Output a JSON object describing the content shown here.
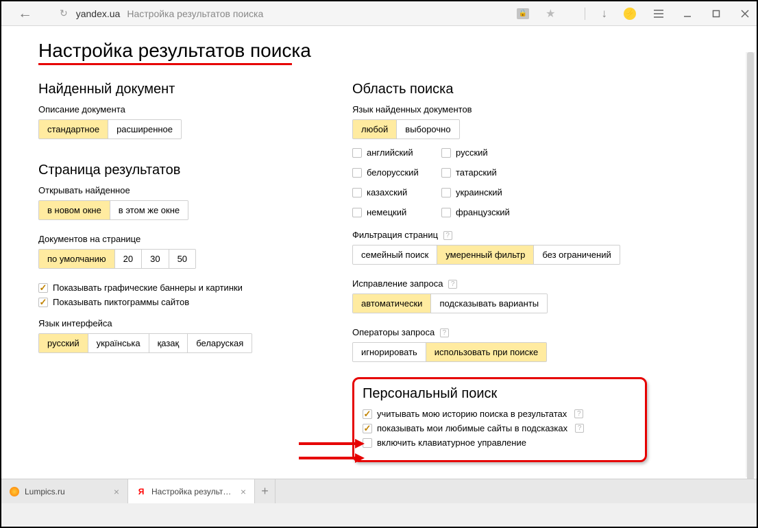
{
  "browser": {
    "domain": "yandex.ua",
    "page_title": "Настройка результатов поиска"
  },
  "page": {
    "heading": "Настройка результатов поиска"
  },
  "left": {
    "found_doc": {
      "title": "Найденный документ",
      "desc_label": "Описание документа",
      "standard": "стандартное",
      "extended": "расширенное"
    },
    "results_page": {
      "title": "Страница результатов",
      "open_label": "Открывать найденное",
      "new_window": "в новом окне",
      "same_window": "в этом же окне",
      "docs_label": "Документов на странице",
      "default": "по умолчанию",
      "n20": "20",
      "n30": "30",
      "n50": "50",
      "show_banners": "Показывать графические баннеры и картинки",
      "show_favicons": "Показывать пиктограммы сайтов"
    },
    "ui_lang": {
      "label": "Язык интерфейса",
      "ru": "русский",
      "uk": "українська",
      "kk": "қазақ",
      "be": "беларуская"
    }
  },
  "right": {
    "search_area": {
      "title": "Область поиска",
      "lang_label": "Язык найденных документов",
      "any": "любой",
      "select": "выборочно",
      "lang_en": "английский",
      "lang_ru": "русский",
      "lang_be": "белорусский",
      "lang_tt": "татарский",
      "lang_kk": "казахский",
      "lang_uk": "украинский",
      "lang_de": "немецкий",
      "lang_fr": "французский"
    },
    "filter": {
      "label": "Фильтрация страниц",
      "family": "семейный поиск",
      "moderate": "умеренный фильтр",
      "none": "без ограничений"
    },
    "spell": {
      "label": "Исправление запроса",
      "auto": "автоматически",
      "suggest": "подсказывать варианты"
    },
    "ops": {
      "label": "Операторы запроса",
      "ignore": "игнорировать",
      "use": "использовать при поиске"
    },
    "personal": {
      "title": "Персональный поиск",
      "history": "учитывать мою историю поиска в результатах",
      "fav": "показывать мои любимые сайты в подсказках",
      "kbd": "включить клавиатурное управление"
    }
  },
  "tabs": {
    "t1": "Lumpics.ru",
    "t2": "Настройка результатов п"
  }
}
